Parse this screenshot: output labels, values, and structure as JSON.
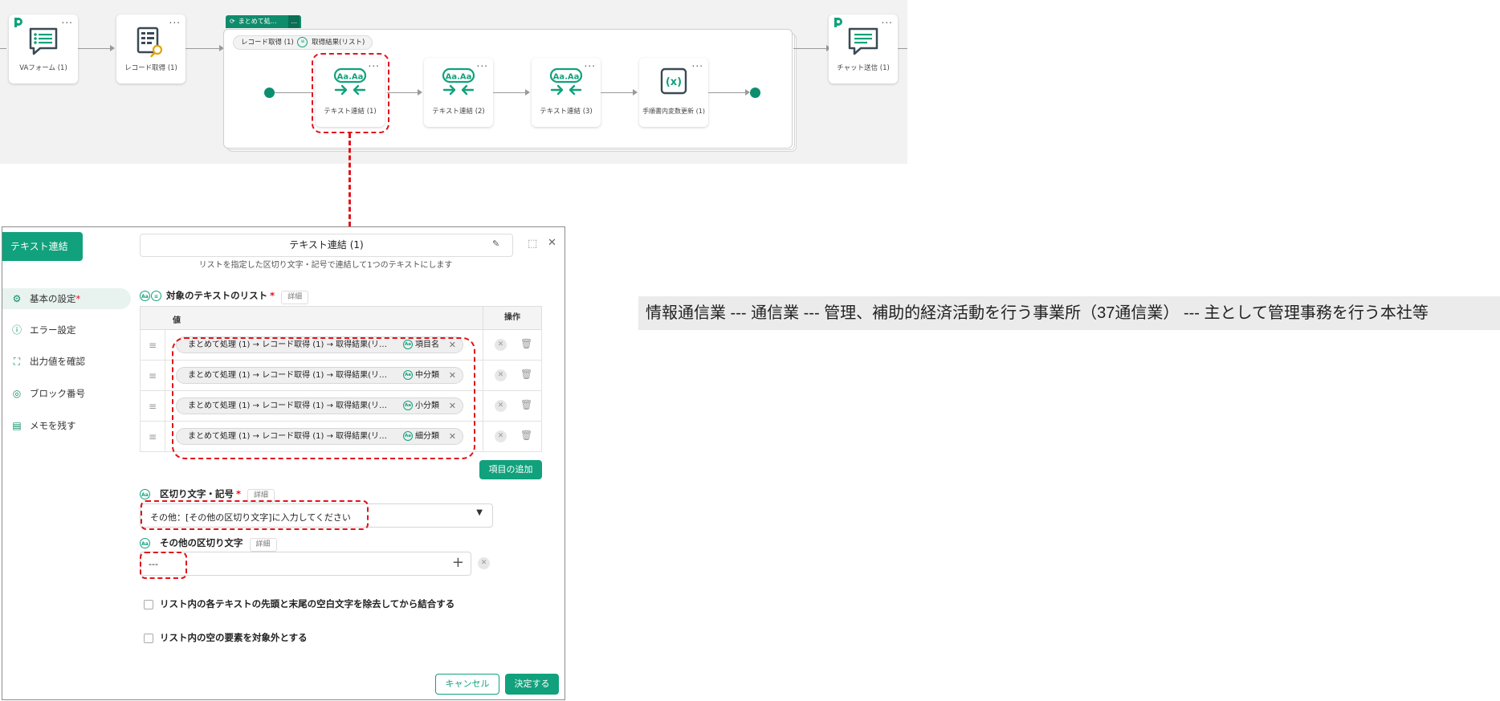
{
  "workflow": {
    "nodes": [
      {
        "id": "va-form",
        "label": "VAフォーム (1)",
        "icon": "form-list-icon"
      },
      {
        "id": "record-get",
        "label": "レコード取得 (1)",
        "icon": "table-search-icon"
      },
      {
        "id": "text-concat-1",
        "label": "テキスト連結 (1)",
        "icon": "text-concat-icon"
      },
      {
        "id": "text-concat-2",
        "label": "テキスト連結 (2)",
        "icon": "text-concat-icon"
      },
      {
        "id": "text-concat-3",
        "label": "テキスト連結 (3)",
        "icon": "text-concat-icon"
      },
      {
        "id": "var-update",
        "label": "手順書内変数更新 (1)",
        "icon": "variable-icon"
      },
      {
        "id": "chat-send",
        "label": "チャット送信 (1)",
        "icon": "chat-list-icon"
      }
    ],
    "group": {
      "tab_label": "まとめて処…",
      "tab_menu": "...",
      "chip_record": "レコード取得 (1)",
      "chip_result": "取得結果(リスト)"
    },
    "node_menu": "...",
    "aa_glyph": "Aa.Aa",
    "var_glyph": "(x)"
  },
  "dialog": {
    "tab_label": "テキスト連結",
    "title": "テキスト連結 (1)",
    "subtitle": "リストを指定した区切り文字・記号で連結して1つのテキストにします",
    "sidebar": [
      {
        "label": "基本の設定",
        "required": "*",
        "icon": "gear-icon",
        "glyph": "⚙"
      },
      {
        "label": "エラー設定",
        "icon": "error-icon",
        "glyph": "ⓘ"
      },
      {
        "label": "出力値を確認",
        "icon": "output-frame-icon",
        "glyph": "⛶"
      },
      {
        "label": "ブロック番号",
        "icon": "block-number-icon",
        "glyph": "◎"
      },
      {
        "label": "メモを残す",
        "icon": "memo-icon",
        "glyph": "▤"
      }
    ],
    "list_section": {
      "heading": "対象のテキストのリスト",
      "required": "*",
      "detail": "詳細",
      "col_value": "値",
      "col_ops": "操作",
      "rows": [
        {
          "path": "まとめて処理 (1) → レコード取得 (1) → 取得結果(リ…",
          "field": "項目名"
        },
        {
          "path": "まとめて処理 (1) → レコード取得 (1) → 取得結果(リ…",
          "field": "中分類"
        },
        {
          "path": "まとめて処理 (1) → レコード取得 (1) → 取得結果(リ…",
          "field": "小分類"
        },
        {
          "path": "まとめて処理 (1) → レコード取得 (1) → 取得結果(リ…",
          "field": "細分類"
        }
      ],
      "add_button": "項目の追加"
    },
    "delimiter_section": {
      "heading": "区切り文字・記号",
      "required": "*",
      "detail": "詳細",
      "selected": "その他：[その他の区切り文字]に入力してください"
    },
    "other_delimiter_section": {
      "heading": "その他の区切り文字",
      "detail": "詳細",
      "value": "---"
    },
    "checkboxes": [
      {
        "label": "リスト内の各テキストの先頭と末尾の空白文字を除去してから結合する",
        "checked": false
      },
      {
        "label": "リスト内の空の要素を対象外とする",
        "checked": false
      }
    ],
    "cancel_button": "キャンセル",
    "confirm_button": "決定する"
  },
  "result": {
    "text": "情報通信業 --- 通信業 --- 管理、補助的経済活動を行う事業所（37通信業） --- 主として管理事務を行う本社等"
  },
  "colors": {
    "accent": "#11a17c",
    "highlight": "#e0141b",
    "canvas": "#f2f2f2"
  }
}
